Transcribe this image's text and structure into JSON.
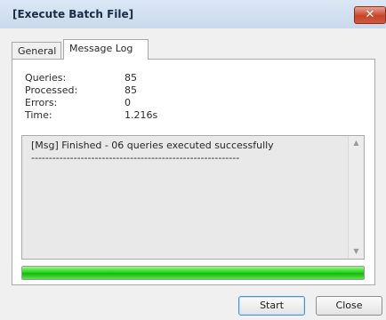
{
  "window": {
    "title": "[Execute Batch File]",
    "close_symbol": "✕"
  },
  "tabs": [
    {
      "label": "General",
      "active": false
    },
    {
      "label": "Message Log",
      "active": true
    }
  ],
  "stats": [
    {
      "label": "Queries:",
      "value": "85"
    },
    {
      "label": "Processed:",
      "value": "85"
    },
    {
      "label": "Errors:",
      "value": "0"
    },
    {
      "label": "Time:",
      "value": "1.216s"
    }
  ],
  "log": {
    "lines": [
      "[Msg] Finished - 06 queries executed successfully",
      "-----------------------------------------------------------"
    ]
  },
  "scrollbar": {
    "up": "▲",
    "down": "▼"
  },
  "progress": {
    "percent": 100,
    "color": "#22d61a"
  },
  "buttons": {
    "start": "Start",
    "close": "Close"
  }
}
